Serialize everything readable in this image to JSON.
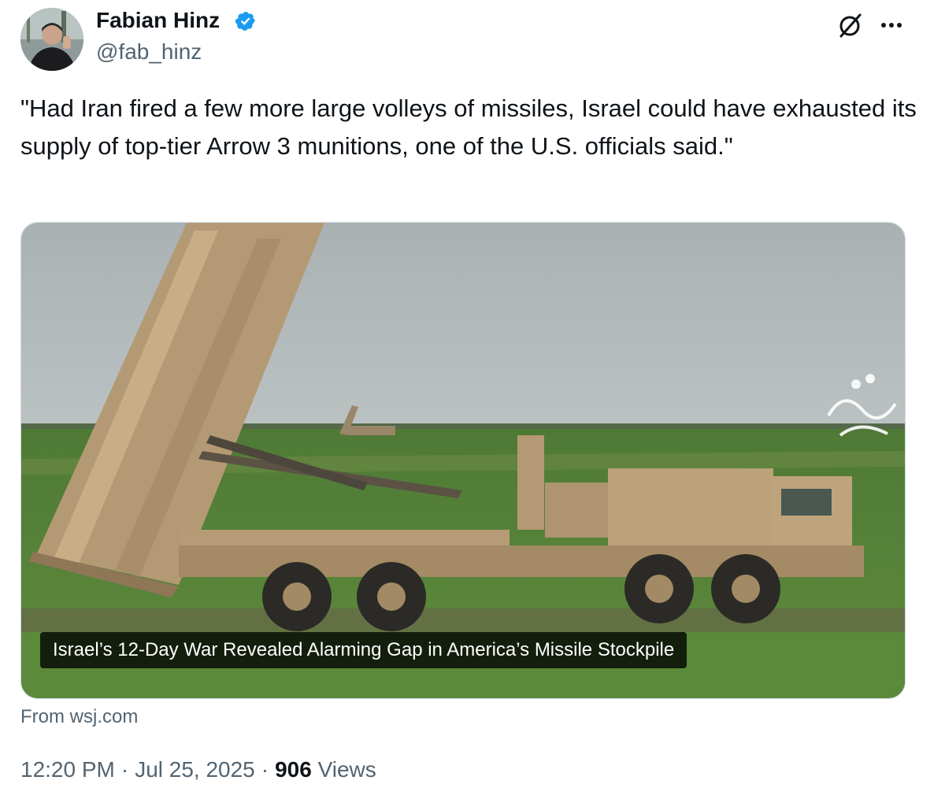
{
  "author": {
    "name": "Fabian Hinz",
    "handle": "@fab_hinz",
    "verified": true
  },
  "icons": {
    "verified": "verified-badge-icon",
    "grok": "grok-icon",
    "more": "more-options-icon"
  },
  "tweet": {
    "text": "\"Had Iran fired a few more large volleys of missiles, Israel could have exhausted its supply of top-tier Arrow 3 munitions, one of the U.S. officials said.\""
  },
  "media": {
    "caption": "Israel’s 12-Day War Revealed Alarming Gap in America’s Missile Stockpile",
    "source": "From wsj.com"
  },
  "meta": {
    "time": "12:20 PM",
    "date": "Jul 25, 2025",
    "views_count": "906",
    "views_label": "Views"
  },
  "colors": {
    "verified": "#1d9bf0",
    "secondary_text": "#536471",
    "primary_text": "#0f1419",
    "border": "#cfd9de"
  }
}
